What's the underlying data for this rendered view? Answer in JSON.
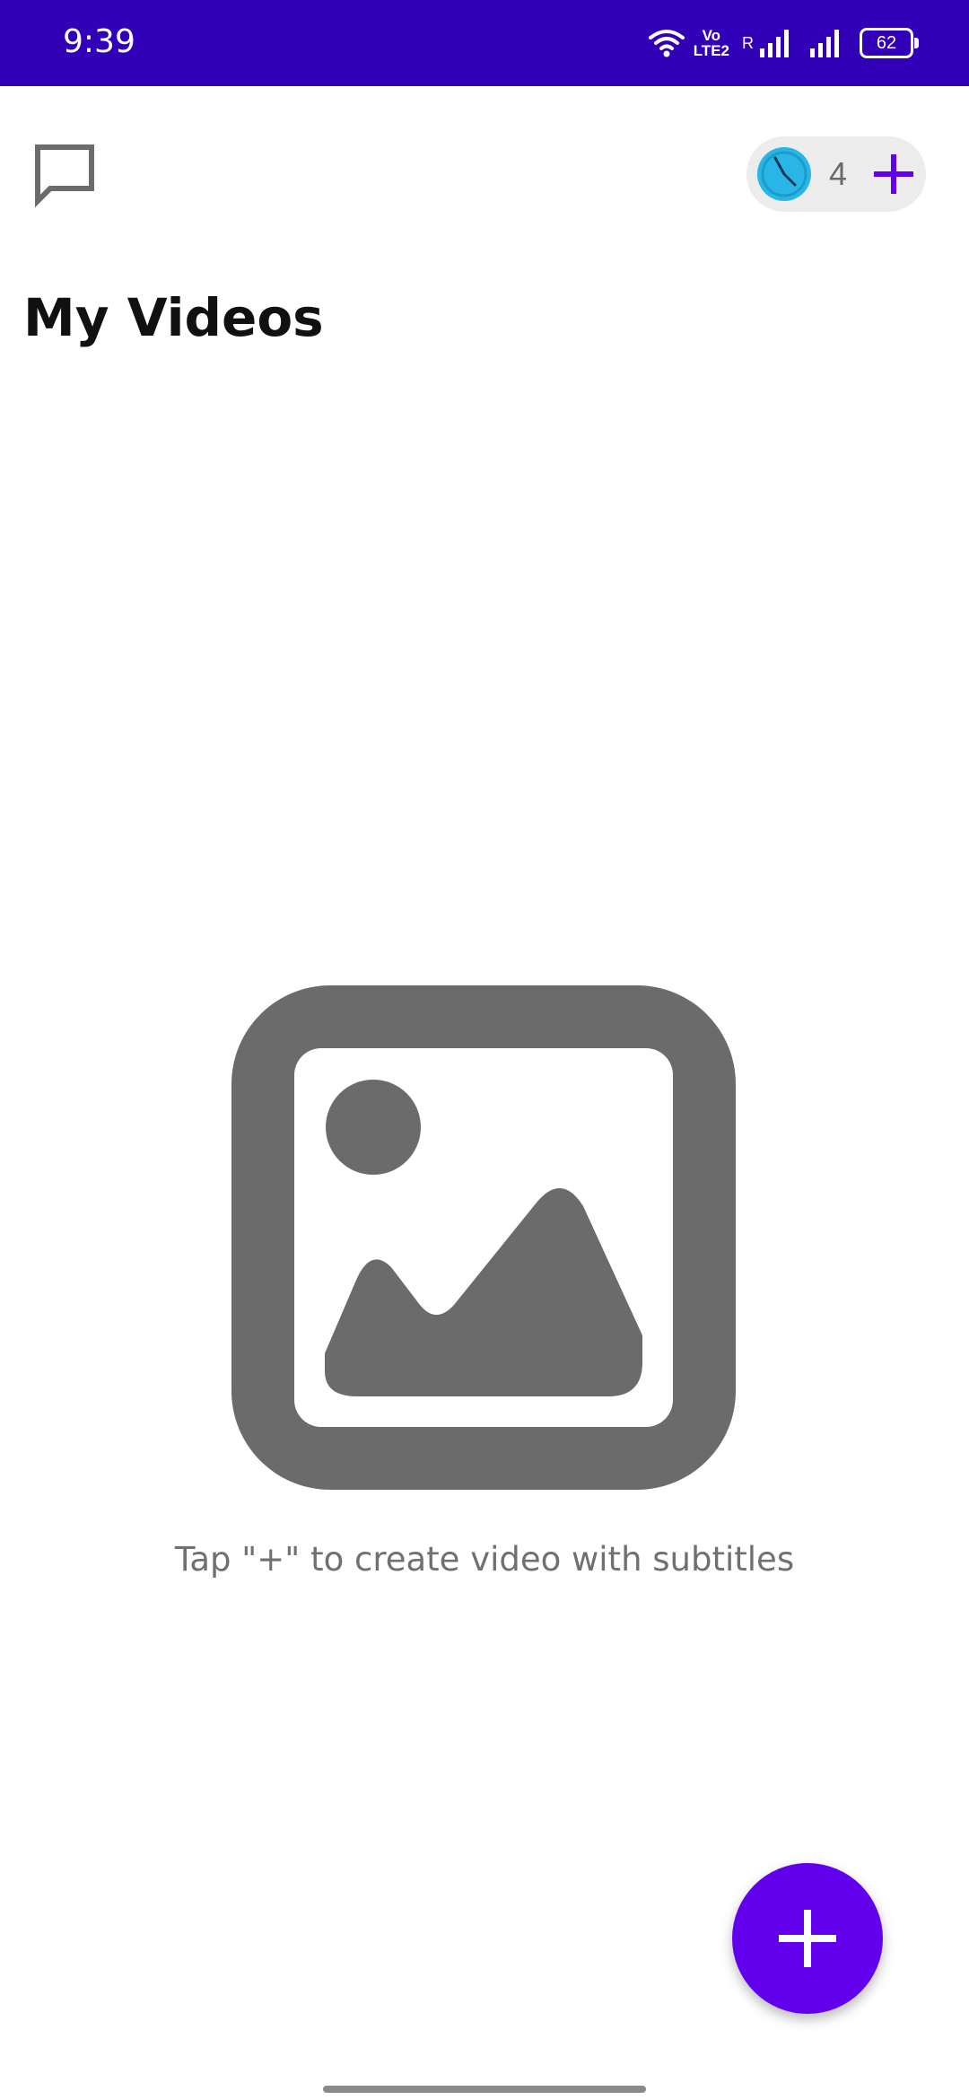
{
  "status_bar": {
    "time": "9:39",
    "volte_top": "Vo",
    "volte_bottom": "LTE2",
    "roaming": "R",
    "battery": "62",
    "background": "#3200b6"
  },
  "header": {
    "chat_icon": "chat-bubble-icon",
    "credits": {
      "count": "4",
      "clock_icon": "clock-icon",
      "add_icon": "plus-icon"
    },
    "title": "My Videos"
  },
  "empty_state": {
    "icon": "image-placeholder-icon",
    "message": "Tap \"+\" to create video with subtitles"
  },
  "fab": {
    "icon": "plus-icon",
    "color": "#6200ee"
  },
  "colors": {
    "accent": "#6200ee",
    "clock": "#29b6e6",
    "icon_gray": "#6b6b6b"
  }
}
